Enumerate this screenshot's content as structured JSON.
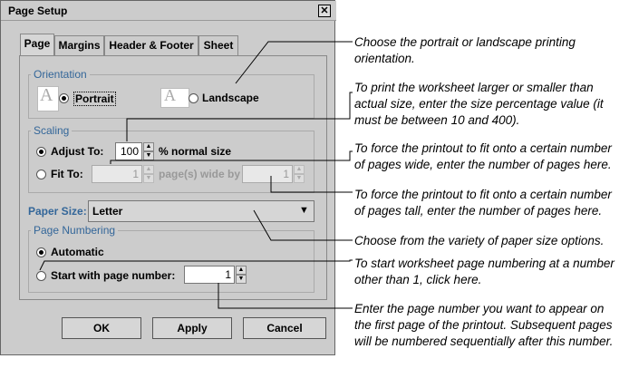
{
  "dialog": {
    "title": "Page Setup",
    "close_glyph": "✕",
    "tabs": [
      {
        "label": "Page",
        "active": true
      },
      {
        "label": "Margins",
        "active": false
      },
      {
        "label": "Header & Footer",
        "active": false
      },
      {
        "label": "Sheet",
        "active": false
      }
    ],
    "orientation": {
      "legend": "Orientation",
      "portrait_label": "Portrait",
      "landscape_label": "Landscape",
      "selected": "portrait"
    },
    "scaling": {
      "legend": "Scaling",
      "adjust_to_label": "Adjust To:",
      "adjust_to_value": "100",
      "adjust_to_suffix": "% normal size",
      "fit_to_label": "Fit To:",
      "fit_wide_value": "1",
      "fit_wide_suffix": "page(s) wide by",
      "fit_tall_value": "1",
      "selected": "adjust_to"
    },
    "paper_size": {
      "label": "Paper Size:",
      "value": "Letter"
    },
    "page_numbering": {
      "legend": "Page Numbering",
      "automatic_label": "Automatic",
      "start_label": "Start with page number:",
      "start_value": "1",
      "selected": "automatic"
    },
    "buttons": {
      "ok": "OK",
      "apply": "Apply",
      "cancel": "Cancel"
    }
  },
  "annotations": [
    {
      "lines": [
        "Choose the portrait or landscape printing",
        "orientation."
      ]
    },
    {
      "lines": [
        "To print the worksheet larger or smaller than",
        "actual size, enter the size percentage value (it",
        "must be between 10 and 400)."
      ]
    },
    {
      "lines": [
        "To force the printout to fit onto a certain number",
        "of pages wide, enter the number of pages here."
      ]
    },
    {
      "lines": [
        "To force the printout to fit onto a certain number",
        "of pages tall, enter the number of pages here."
      ]
    },
    {
      "lines": [
        "Choose from the variety of paper size options."
      ]
    },
    {
      "lines": [
        "To start worksheet page numbering at a number",
        "other than 1, click here."
      ]
    },
    {
      "lines": [
        "Enter the page number you want to appear on",
        "the first page of the printout. Subsequent pages",
        "will be numbered sequentially after this number."
      ]
    }
  ]
}
